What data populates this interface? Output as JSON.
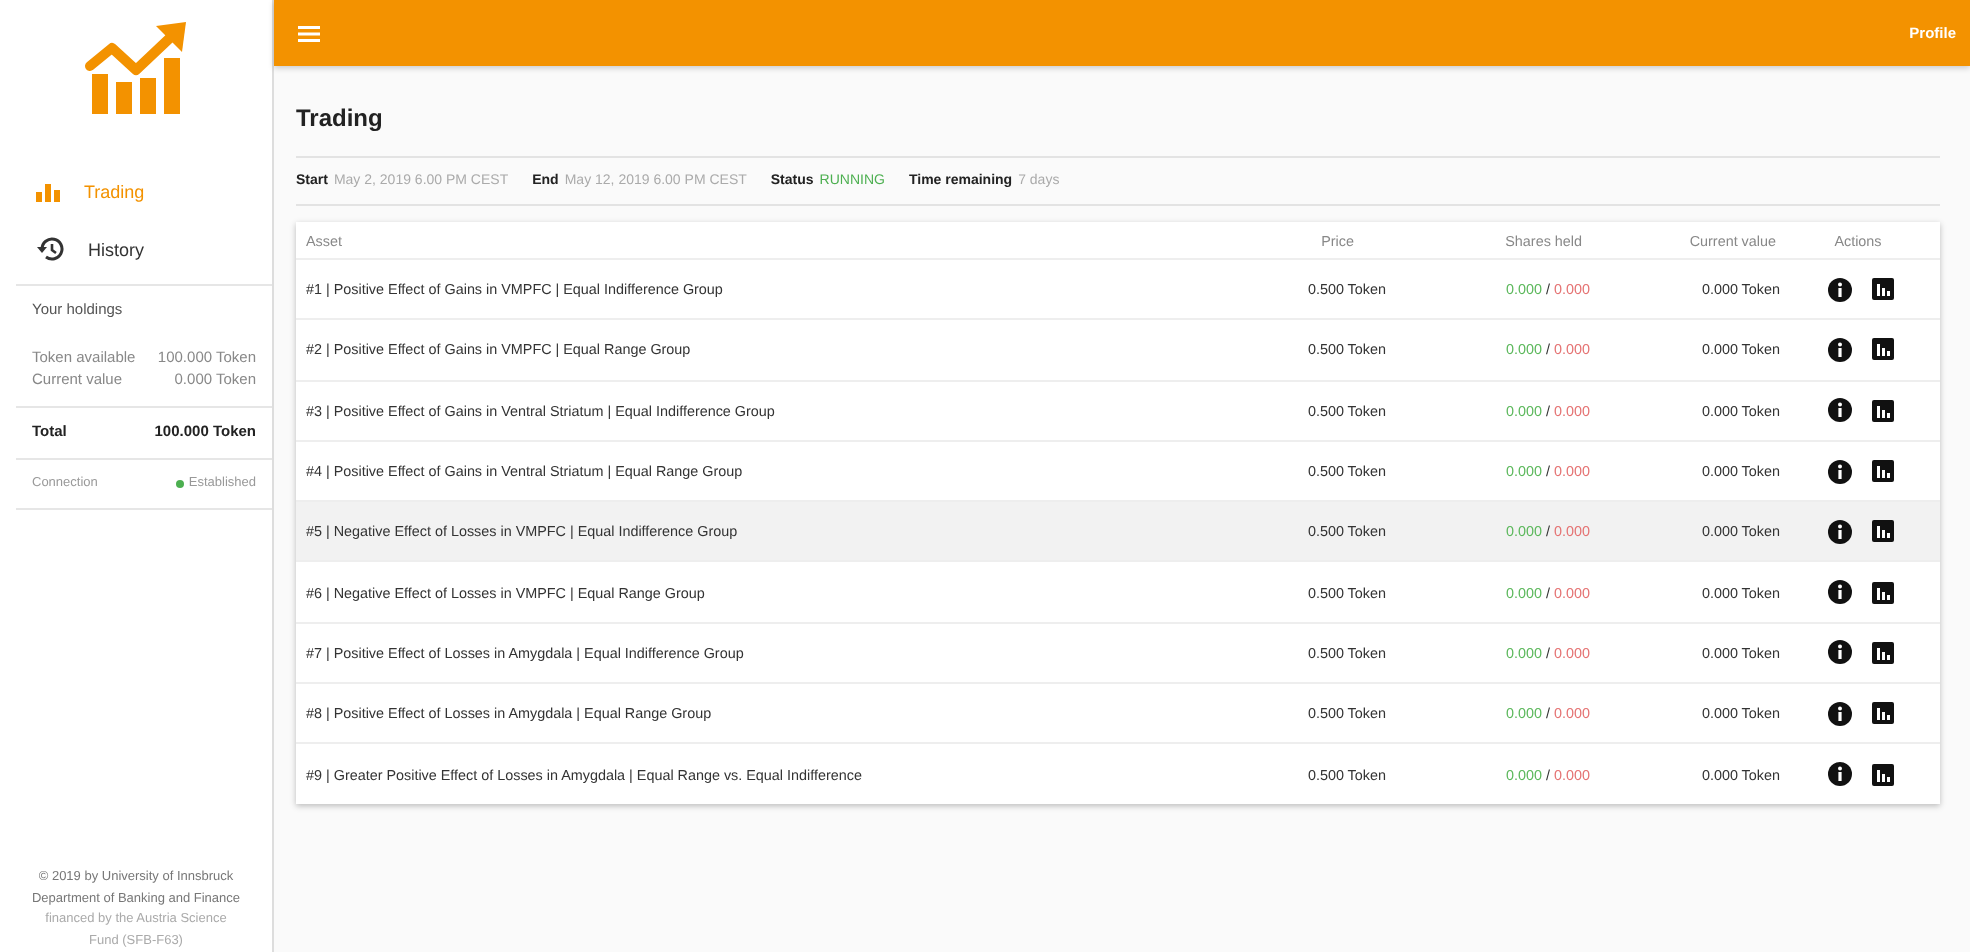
{
  "sidebar": {
    "nav": [
      {
        "label": "Trading",
        "selected": true
      },
      {
        "label": "History",
        "selected": false
      }
    ],
    "holdings_title": "Your holdings",
    "holdings": [
      {
        "label": "Token available",
        "value": "100.000 Token"
      },
      {
        "label": "Current value",
        "value": "0.000 Token"
      }
    ],
    "total": {
      "label": "Total",
      "value": "100.000 Token"
    },
    "connection": {
      "label": "Connection",
      "value": "Established",
      "color": "#4caf50"
    },
    "footer": [
      "© 2019 by University of Innsbruck",
      "Department of Banking and Finance",
      "financed by the Austria Science",
      "Fund (SFB-F63)"
    ]
  },
  "header": {
    "profile": "Profile"
  },
  "page_title": "Trading",
  "info": [
    {
      "label": "Start",
      "value": "May 2, 2019 6.00 PM CEST",
      "kind": "plain"
    },
    {
      "label": "End",
      "value": "May 12, 2019 6.00 PM CEST",
      "kind": "plain"
    },
    {
      "label": "Status",
      "value": "RUNNING",
      "kind": "status"
    },
    {
      "label": "Time remaining",
      "value": "7 days",
      "kind": "plain"
    }
  ],
  "table": {
    "separator": "/",
    "columns": [
      "Asset",
      "Price",
      "Shares held",
      "Current value",
      "Actions"
    ],
    "rows": [
      {
        "asset": "#1 | Positive Effect of Gains in VMPFC | Equal Indifference Group",
        "price": "0.500 Token",
        "long": "0.000",
        "short": "0.000",
        "value": "0.000 Token",
        "highlighted": false
      },
      {
        "asset": "#2 | Positive Effect of Gains in VMPFC | Equal Range Group",
        "price": "0.500 Token",
        "long": "0.000",
        "short": "0.000",
        "value": "0.000 Token",
        "highlighted": false
      },
      {
        "asset": "#3 | Positive Effect of Gains in Ventral Striatum | Equal Indifference Group",
        "price": "0.500 Token",
        "long": "0.000",
        "short": "0.000",
        "value": "0.000 Token",
        "highlighted": false
      },
      {
        "asset": "#4 | Positive Effect of Gains in Ventral Striatum | Equal Range Group",
        "price": "0.500 Token",
        "long": "0.000",
        "short": "0.000",
        "value": "0.000 Token",
        "highlighted": false
      },
      {
        "asset": "#5 | Negative Effect of Losses in VMPFC | Equal Indifference Group",
        "price": "0.500 Token",
        "long": "0.000",
        "short": "0.000",
        "value": "0.000 Token",
        "highlighted": true
      },
      {
        "asset": "#6 | Negative Effect of Losses in VMPFC | Equal Range Group",
        "price": "0.500 Token",
        "long": "0.000",
        "short": "0.000",
        "value": "0.000 Token",
        "highlighted": false
      },
      {
        "asset": "#7 | Positive Effect of Losses in Amygdala | Equal Indifference Group",
        "price": "0.500 Token",
        "long": "0.000",
        "short": "0.000",
        "value": "0.000 Token",
        "highlighted": false
      },
      {
        "asset": "#8 | Positive Effect of Losses in Amygdala | Equal Range Group",
        "price": "0.500 Token",
        "long": "0.000",
        "short": "0.000",
        "value": "0.000 Token",
        "highlighted": false
      },
      {
        "asset": "#9 | Greater Positive Effect of Losses in Amygdala | Equal Range vs. Equal Indifference",
        "price": "0.500 Token",
        "long": "0.000",
        "short": "0.000",
        "value": "0.000 Token",
        "highlighted": false
      }
    ]
  }
}
